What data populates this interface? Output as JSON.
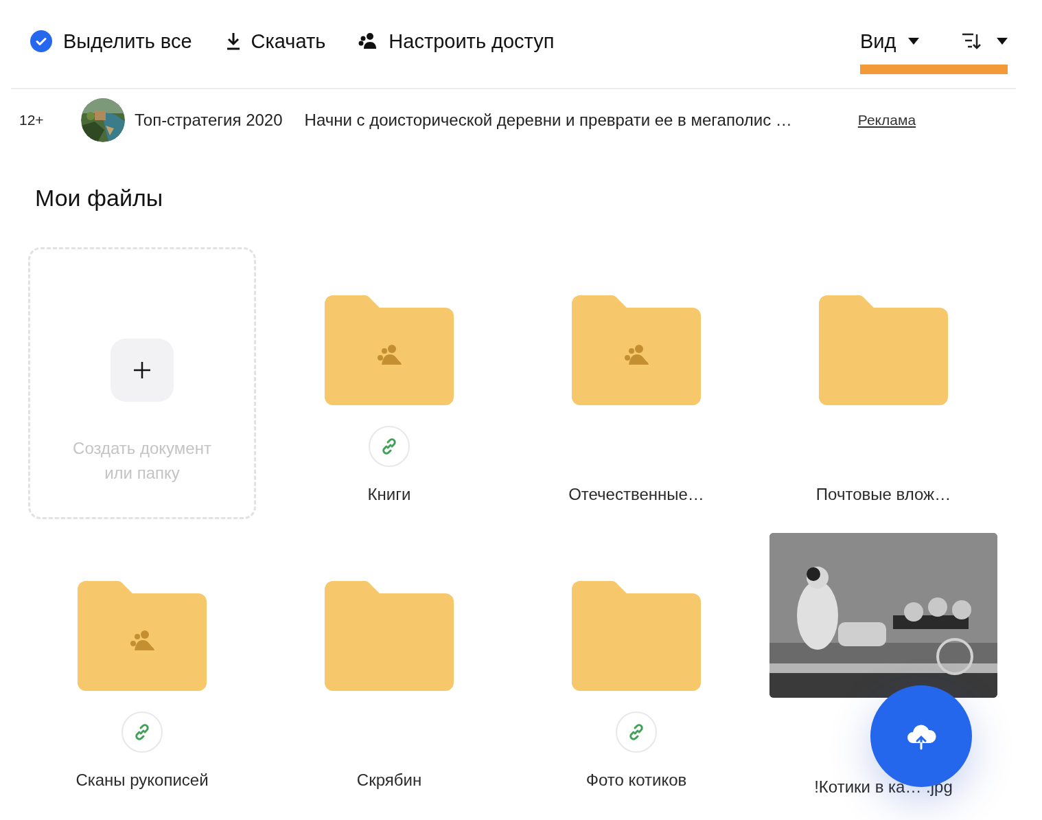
{
  "toolbar": {
    "select_all": {
      "label": "Выделить все",
      "checked": true
    },
    "actions": [
      {
        "kind": "download",
        "label": "Скачать"
      },
      {
        "kind": "share",
        "label": "Настроить доступ"
      }
    ],
    "view": {
      "label": "Вид"
    }
  },
  "ad": {
    "age": "12+",
    "title": "Топ-стратегия 2020",
    "text": "Начни с доисторической деревни и преврати ее в мегаполис …",
    "link": "Реклама"
  },
  "title": "Мои файлы",
  "create": {
    "label": "Создать документ или папку"
  },
  "items": [
    {
      "kind": "folder",
      "name": "Книги",
      "shared": true,
      "link": true
    },
    {
      "kind": "folder",
      "name": "Отечественные…",
      "shared": true,
      "link": false
    },
    {
      "kind": "folder",
      "name": "Почтовые влож…",
      "shared": false,
      "link": false
    },
    {
      "kind": "folder",
      "name": "Сканы рукописей",
      "shared": true,
      "link": true
    },
    {
      "kind": "folder",
      "name": "Скрябин",
      "shared": false,
      "link": false
    },
    {
      "kind": "folder",
      "name": "Фото котиков",
      "shared": false,
      "link": true
    },
    {
      "name": "!Котики в ка… .jpg"
    }
  ]
}
